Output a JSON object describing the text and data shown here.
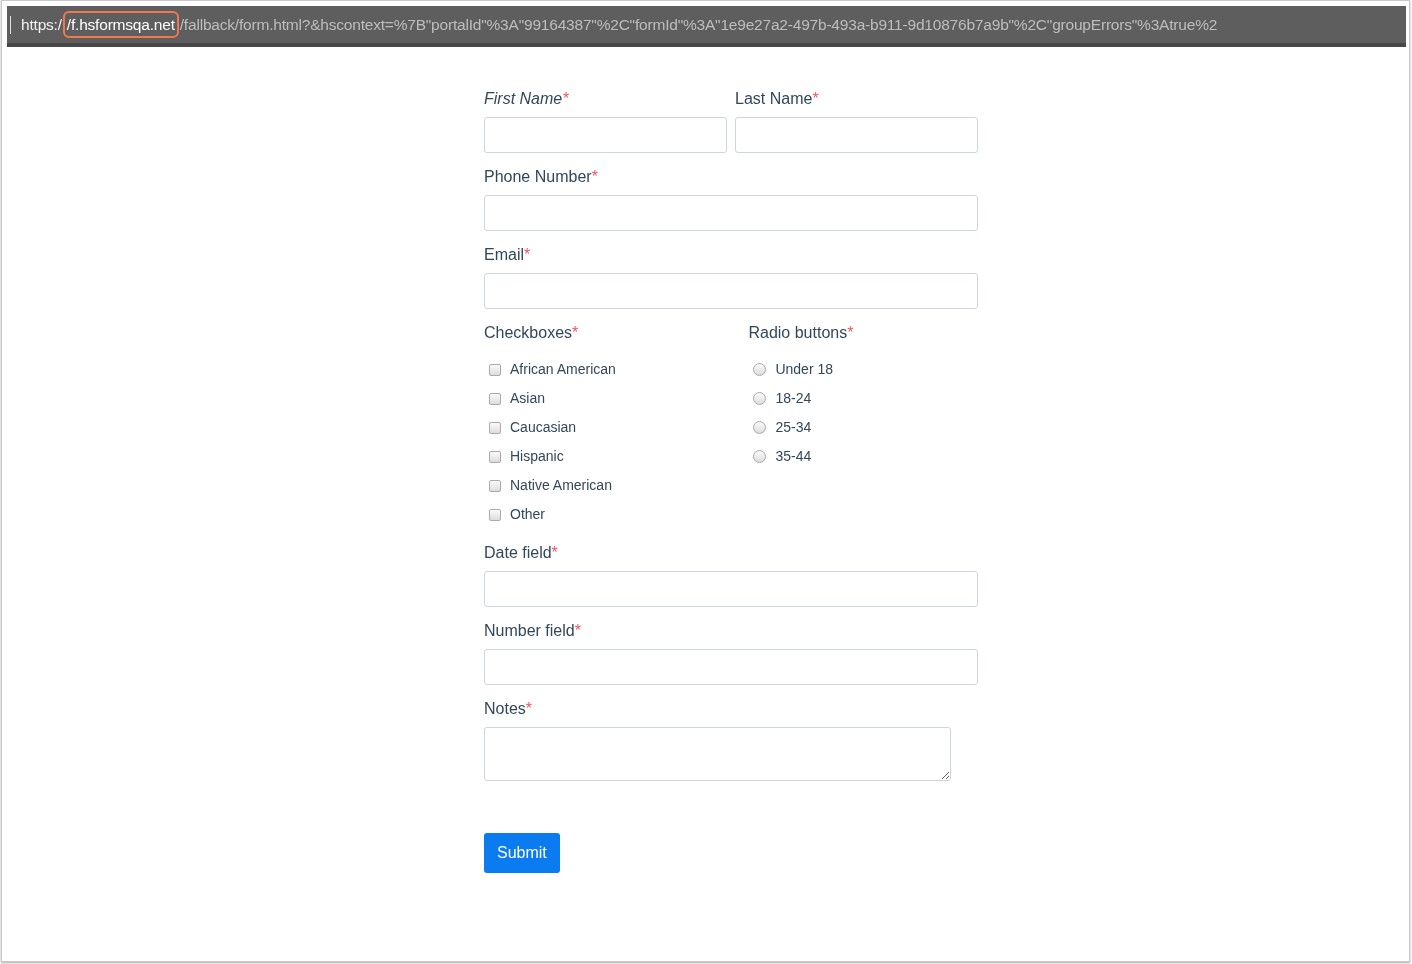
{
  "address_bar": {
    "scheme": "https:/",
    "host": "/f.hsformsqa.net",
    "path": "/fallback/form.html?&hscontext=%7B\"portalId\"%3A\"99164387\"%2C\"formId\"%3A\"1e9e27a2-497b-493a-b911-9d10876b7a9b\"%2C\"groupErrors\"%3Atrue%2",
    "host_highlighted": true
  },
  "form": {
    "rows": [
      {
        "fields": [
          {
            "kind": "text",
            "label": "First Name",
            "required": true,
            "italic": true
          },
          {
            "kind": "text",
            "label": "Last Name",
            "required": true,
            "italic": false
          }
        ]
      },
      {
        "fields": [
          {
            "kind": "text",
            "label": "Phone Number",
            "required": true,
            "italic": false
          }
        ]
      },
      {
        "fields": [
          {
            "kind": "text",
            "label": "Email",
            "required": true,
            "italic": false
          }
        ]
      },
      {
        "fields": [
          {
            "kind": "checkboxes",
            "label": "Checkboxes",
            "required": true,
            "italic": false,
            "options": [
              {
                "label": "African American",
                "checked": false
              },
              {
                "label": "Asian",
                "checked": false
              },
              {
                "label": "Caucasian",
                "checked": false
              },
              {
                "label": "Hispanic",
                "checked": false
              },
              {
                "label": "Native American",
                "checked": false
              },
              {
                "label": "Other",
                "checked": false
              }
            ]
          },
          {
            "kind": "radios",
            "label": "Radio buttons",
            "required": true,
            "italic": false,
            "options": [
              {
                "label": "Under 18",
                "selected": false
              },
              {
                "label": "18-24",
                "selected": false
              },
              {
                "label": "25-34",
                "selected": false
              },
              {
                "label": "35-44",
                "selected": false
              }
            ]
          }
        ]
      },
      {
        "fields": [
          {
            "kind": "text",
            "label": "Date field",
            "required": true,
            "italic": false
          }
        ]
      },
      {
        "fields": [
          {
            "kind": "text",
            "label": "Number field",
            "required": true,
            "italic": false
          }
        ]
      },
      {
        "fields": [
          {
            "kind": "textarea",
            "label": "Notes",
            "required": true,
            "italic": false
          }
        ]
      }
    ],
    "required_mark": "*",
    "submit": "Submit"
  }
}
